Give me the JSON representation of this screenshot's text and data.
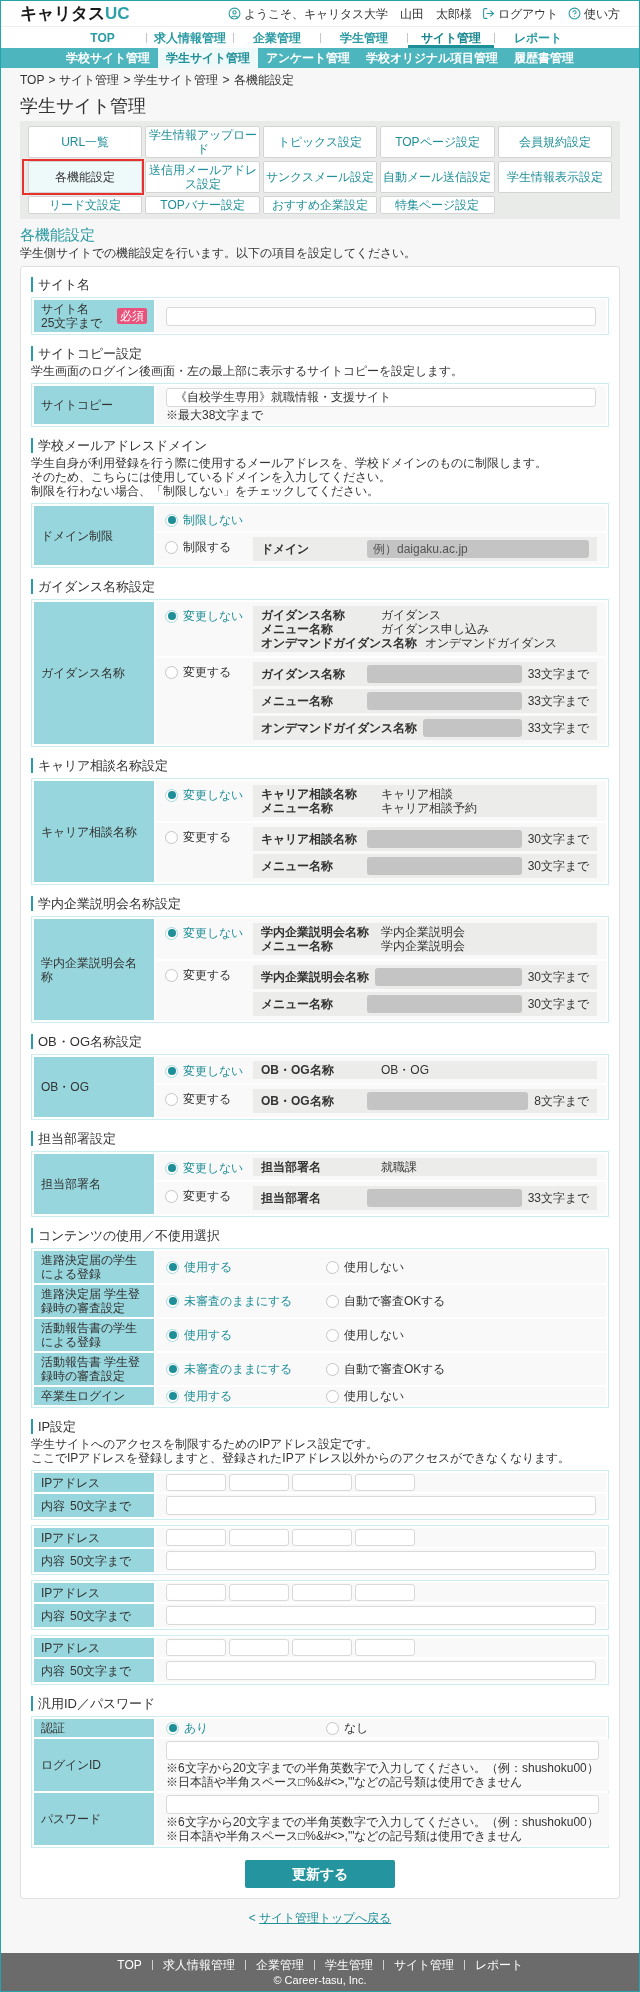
{
  "header": {
    "logo": {
      "text": "キャリタス",
      "accent": "UC"
    },
    "welcome": "ようこそ、キャリタス大学　山田　太郎様",
    "logout": "ログアウト",
    "help": "使い方"
  },
  "main_nav": [
    {
      "label": "TOP",
      "selected": false
    },
    {
      "label": "求人情報管理",
      "selected": false
    },
    {
      "label": "企業管理",
      "selected": false
    },
    {
      "label": "学生管理",
      "selected": false
    },
    {
      "label": "サイト管理",
      "selected": true
    },
    {
      "label": "レポート",
      "selected": false
    }
  ],
  "sub_nav": [
    {
      "label": "学校サイト管理",
      "selected": false
    },
    {
      "label": "学生サイト管理",
      "selected": true
    },
    {
      "label": "アンケート管理",
      "selected": false
    },
    {
      "label": "学校オリジナル項目管理",
      "selected": false
    },
    {
      "label": "履歴書管理",
      "selected": false
    }
  ],
  "breadcrumb": {
    "separator": ">",
    "items": [
      "TOP",
      "サイト管理",
      "学生サイト管理",
      "各機能設定"
    ]
  },
  "page_title": "学生サイト管理",
  "menu_buttons": [
    {
      "label": "URL一覧",
      "selected": false,
      "highlighted": false
    },
    {
      "label": "学生情報アップロード",
      "selected": false,
      "highlighted": false
    },
    {
      "label": "トピックス設定",
      "selected": false,
      "highlighted": false
    },
    {
      "label": "TOPページ設定",
      "selected": false,
      "highlighted": false
    },
    {
      "label": "会員規約設定",
      "selected": false,
      "highlighted": false
    },
    {
      "label": "各機能設定",
      "selected": true,
      "highlighted": true
    },
    {
      "label": "送信用メールアドレス設定",
      "selected": false,
      "highlighted": false
    },
    {
      "label": "サンクスメール設定",
      "selected": false,
      "highlighted": false
    },
    {
      "label": "自動メール送信設定",
      "selected": false,
      "highlighted": false
    },
    {
      "label": "学生情報表示設定",
      "selected": false,
      "highlighted": false
    },
    {
      "label": "リード文設定",
      "selected": false,
      "highlighted": false
    },
    {
      "label": "TOPバナー設定",
      "selected": false,
      "highlighted": false
    },
    {
      "label": "おすすめ企業設定",
      "selected": false,
      "highlighted": false
    },
    {
      "label": "特集ページ設定",
      "selected": false,
      "highlighted": false
    }
  ],
  "section_title": "各機能設定",
  "section_description": "学生側サイトでの機能設定を行います。以下の項目を設定してください。",
  "form_sections": [
    {
      "heading": "サイト名",
      "tables": [
        {
          "rows": [
            {
              "kind": "input",
              "label": "サイト名",
              "label_note": "25文字まで",
              "badge": "必須"
            }
          ]
        }
      ]
    },
    {
      "heading": "サイトコピー設定",
      "description": [
        "学生画面のログイン後画面・左の最上部に表示するサイトコピーを設定します。"
      ],
      "tables": [
        {
          "rows": [
            {
              "kind": "input",
              "label": "サイトコピー",
              "value": "《自校学生専用》就職情報・支援サイト",
              "hints": [
                "※最大38文字まで"
              ]
            }
          ]
        }
      ]
    },
    {
      "heading": "学校メールアドレスドメイン",
      "description": [
        "学生自身が利用登録を行う際に使用するメールアドレスを、学校ドメインのものに制限します。",
        "そのため、こちらには使用しているドメインを入力してください。",
        "制限を行わない場合、「制限しない」をチェックしてください。"
      ],
      "tables": [
        {
          "rows": [
            {
              "kind": "choice",
              "label": "ドメイン制限",
              "options": [
                {
                  "label": "制限しない",
                  "selected": true
                },
                {
                  "label": "制限する",
                  "selected": false,
                  "fields": [
                    {
                      "label": "ドメイン",
                      "placeholder": "例）daigaku.ac.jp"
                    }
                  ]
                }
              ]
            }
          ]
        }
      ]
    },
    {
      "heading": "ガイダンス名称設定",
      "tables": [
        {
          "rows": [
            {
              "kind": "choice",
              "label": "ガイダンス名称",
              "options": [
                {
                  "label": "変更しない",
                  "selected": true,
                  "current": [
                    {
                      "name": "ガイダンス名称",
                      "value": "ガイダンス"
                    },
                    {
                      "name": "メニュー名称",
                      "value": "ガイダンス申し込み"
                    },
                    {
                      "name": "オンデマンドガイダンス名称",
                      "value": "オンデマンドガイダンス"
                    }
                  ]
                },
                {
                  "label": "変更する",
                  "selected": false,
                  "fields": [
                    {
                      "label": "ガイダンス名称",
                      "hint": "33文字まで"
                    },
                    {
                      "label": "メニュー名称",
                      "hint": "33文字まで"
                    },
                    {
                      "label": "オンデマンドガイダンス名称",
                      "hint": "33文字まで"
                    }
                  ]
                }
              ]
            }
          ]
        }
      ]
    },
    {
      "heading": "キャリア相談名称設定",
      "tables": [
        {
          "rows": [
            {
              "kind": "choice",
              "label": "キャリア相談名称",
              "options": [
                {
                  "label": "変更しない",
                  "selected": true,
                  "current": [
                    {
                      "name": "キャリア相談名称",
                      "value": "キャリア相談"
                    },
                    {
                      "name": "メニュー名称",
                      "value": "キャリア相談予約"
                    }
                  ]
                },
                {
                  "label": "変更する",
                  "selected": false,
                  "fields": [
                    {
                      "label": "キャリア相談名称",
                      "hint": "30文字まで"
                    },
                    {
                      "label": "メニュー名称",
                      "hint": "30文字まで"
                    }
                  ]
                }
              ]
            }
          ]
        }
      ]
    },
    {
      "heading": "学内企業説明会名称設定",
      "tables": [
        {
          "rows": [
            {
              "kind": "choice",
              "label": "学内企業説明会名称",
              "options": [
                {
                  "label": "変更しない",
                  "selected": true,
                  "current": [
                    {
                      "name": "学内企業説明会名称",
                      "value": "学内企業説明会"
                    },
                    {
                      "name": "メニュー名称",
                      "value": "学内企業説明会"
                    }
                  ]
                },
                {
                  "label": "変更する",
                  "selected": false,
                  "fields": [
                    {
                      "label": "学内企業説明会名称",
                      "hint": "30文字まで"
                    },
                    {
                      "label": "メニュー名称",
                      "hint": "30文字まで"
                    }
                  ]
                }
              ]
            }
          ]
        }
      ]
    },
    {
      "heading": "OB・OG名称設定",
      "tables": [
        {
          "rows": [
            {
              "kind": "choice",
              "label": "OB・OG",
              "options": [
                {
                  "label": "変更しない",
                  "selected": true,
                  "current": [
                    {
                      "name": "OB・OG名称",
                      "value": "OB・OG"
                    }
                  ]
                },
                {
                  "label": "変更する",
                  "selected": false,
                  "fields": [
                    {
                      "label": "OB・OG名称",
                      "hint": "8文字まで"
                    }
                  ]
                }
              ]
            }
          ]
        }
      ]
    },
    {
      "heading": "担当部署設定",
      "tables": [
        {
          "rows": [
            {
              "kind": "choice",
              "label": "担当部署名",
              "options": [
                {
                  "label": "変更しない",
                  "selected": true,
                  "current": [
                    {
                      "name": "担当部署名",
                      "value": "就職課"
                    }
                  ]
                },
                {
                  "label": "変更する",
                  "selected": false,
                  "fields": [
                    {
                      "label": "担当部署名",
                      "hint": "33文字まで"
                    }
                  ]
                }
              ]
            }
          ]
        }
      ]
    },
    {
      "heading": "コンテンツの使用／不使用選択",
      "tables": [
        {
          "rows": [
            {
              "kind": "radio",
              "label": "進路決定届の学生による登録",
              "options": [
                {
                  "label": "使用する",
                  "selected": true
                },
                {
                  "label": "使用しない",
                  "selected": false
                }
              ]
            },
            {
              "kind": "radio",
              "label": "進路決定届 学生登録時の審査設定",
              "options": [
                {
                  "label": "未審査のままにする",
                  "selected": true
                },
                {
                  "label": "自動で審査OKする",
                  "selected": false
                }
              ]
            },
            {
              "kind": "radio",
              "label": "活動報告書の学生による登録",
              "options": [
                {
                  "label": "使用する",
                  "selected": true
                },
                {
                  "label": "使用しない",
                  "selected": false
                }
              ]
            },
            {
              "kind": "radio",
              "label": "活動報告書 学生登録時の審査設定",
              "options": [
                {
                  "label": "未審査のままにする",
                  "selected": true
                },
                {
                  "label": "自動で審査OKする",
                  "selected": false
                }
              ]
            },
            {
              "kind": "radio",
              "label": "卒業生ログイン",
              "options": [
                {
                  "label": "使用する",
                  "selected": true
                },
                {
                  "label": "使用しない",
                  "selected": false
                }
              ]
            }
          ]
        }
      ]
    },
    {
      "heading": "IP設定",
      "description": [
        "学生サイトへのアクセスを制限するためのIPアドレス設定です。",
        "ここでIPアドレスを登録しますと、登録されたIPアドレス以外からのアクセスができなくなります。"
      ],
      "tables": [
        {
          "rows": [
            {
              "kind": "ip",
              "label": "IPアドレス"
            },
            {
              "kind": "input",
              "label": "内容",
              "label_note": "50文字まで"
            }
          ]
        },
        {
          "rows": [
            {
              "kind": "ip",
              "label": "IPアドレス"
            },
            {
              "kind": "input",
              "label": "内容",
              "label_note": "50文字まで"
            }
          ]
        },
        {
          "rows": [
            {
              "kind": "ip",
              "label": "IPアドレス"
            },
            {
              "kind": "input",
              "label": "内容",
              "label_note": "50文字まで"
            }
          ]
        },
        {
          "rows": [
            {
              "kind": "ip",
              "label": "IPアドレス"
            },
            {
              "kind": "input",
              "label": "内容",
              "label_note": "50文字まで"
            }
          ]
        }
      ]
    },
    {
      "heading": "汎用ID／パスワード",
      "tables": [
        {
          "rows": [
            {
              "kind": "radio",
              "label": "認証",
              "options": [
                {
                  "label": "あり",
                  "selected": true
                },
                {
                  "label": "なし",
                  "selected": false
                }
              ]
            },
            {
              "kind": "input",
              "label": "ログインID",
              "hints": [
                "※6文字から20文字までの半角英数字で入力してください。（例：shushoku00）",
                "※日本語や半角スペース□%&#<>,'\"などの記号類は使用できません"
              ]
            },
            {
              "kind": "input",
              "label": "パスワード",
              "hints": [
                "※6文字から20文字までの半角英数字で入力してください。（例：shushoku00）",
                "※日本語や半角スペース□%&#<>,'\"などの記号類は使用できません"
              ]
            }
          ]
        }
      ]
    }
  ],
  "submit_button": "更新する",
  "back_link": {
    "arrow": "<",
    "label": "サイト管理トップへ戻る"
  },
  "footer": {
    "links": [
      "TOP",
      "求人情報管理",
      "企業管理",
      "学生管理",
      "サイト管理",
      "レポート"
    ],
    "copyright": "© Career-tasu, Inc."
  }
}
